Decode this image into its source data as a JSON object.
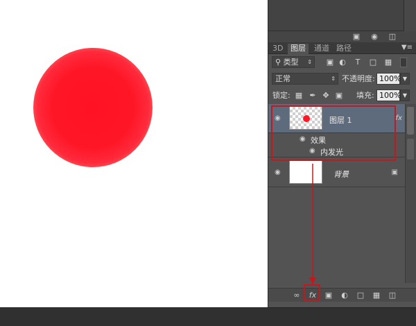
{
  "canvas": {
    "circle_colors": {
      "center": "#ff1626",
      "edge": "#ffcfa8"
    }
  },
  "upper_toolbar": {
    "icons": [
      "new-adjustment-icon",
      "camera-icon",
      "trash-icon"
    ]
  },
  "tabs": [
    {
      "label": "3D",
      "active": false
    },
    {
      "label": "图层",
      "active": true
    },
    {
      "label": "通道",
      "active": false
    },
    {
      "label": "路径",
      "active": false
    }
  ],
  "filter": {
    "kind_label": "类型",
    "icons": [
      "image-filter-icon",
      "adjustment-filter-icon",
      "type-filter-icon",
      "shape-filter-icon",
      "smart-object-filter-icon"
    ]
  },
  "blend": {
    "mode": "正常",
    "opacity_label": "不透明度:",
    "opacity_value": "100%"
  },
  "lock": {
    "label": "锁定:",
    "fill_label": "填充:",
    "fill_value": "100%"
  },
  "layers": [
    {
      "name": "图层 1",
      "fx": "fx",
      "effects_label": "效果",
      "effect_name": "内发光",
      "selected": true
    },
    {
      "name": "背景",
      "locked": true,
      "selected": false
    }
  ],
  "bottom_bar": {
    "icons": [
      "link-icon",
      "fx-icon",
      "mask-icon",
      "adjustment-icon",
      "folder-icon",
      "new-layer-icon",
      "trash-icon"
    ],
    "fx_label": "fx"
  },
  "colors": {
    "highlight": "#c3181e",
    "selected_layer": "#5d6b7d",
    "panel": "#535353"
  }
}
